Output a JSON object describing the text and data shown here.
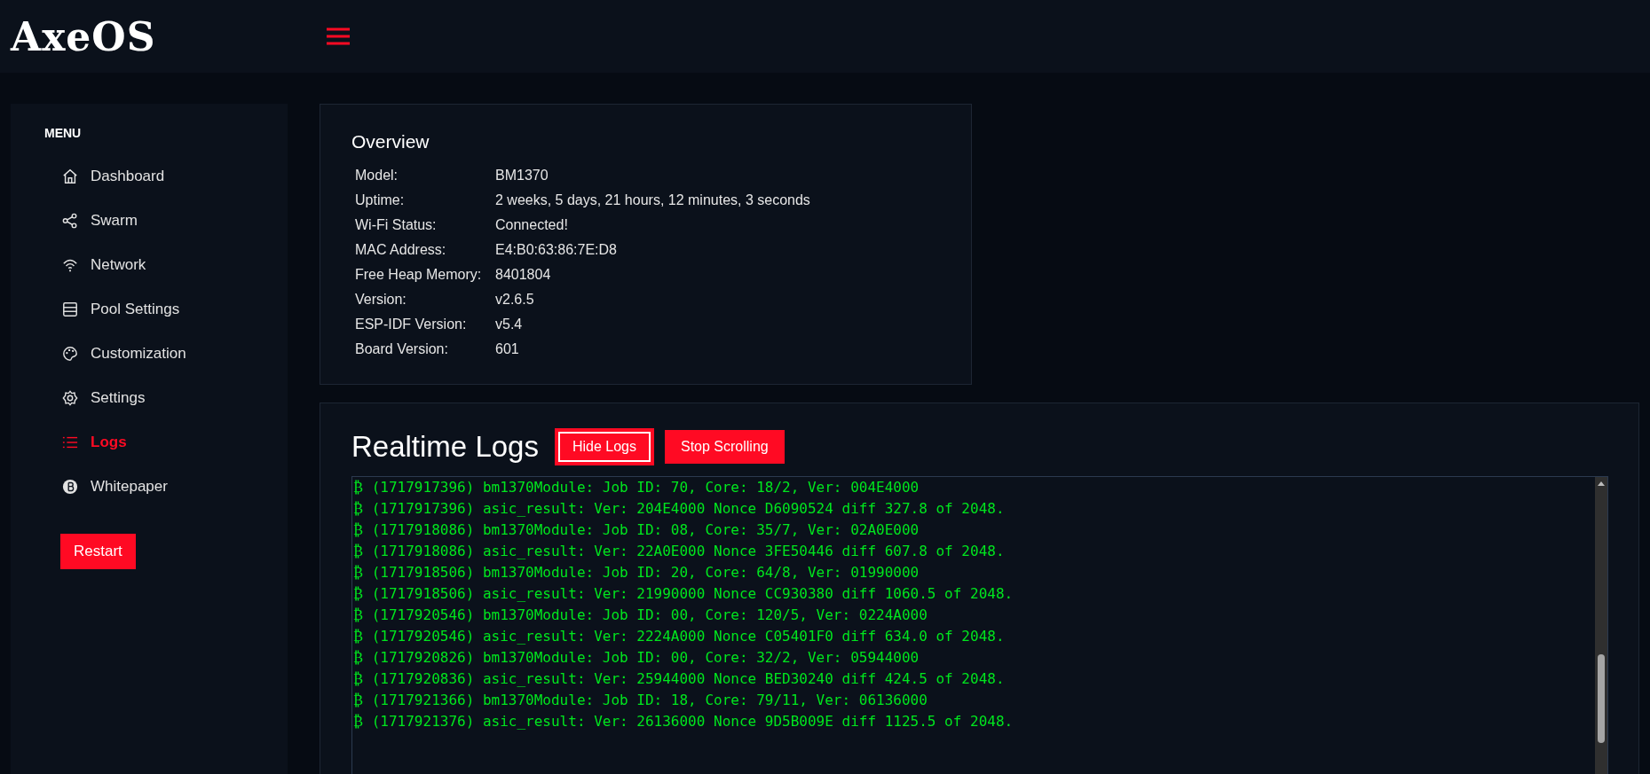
{
  "header": {
    "logo": "AxeOS"
  },
  "sidebar": {
    "heading": "MENU",
    "items": [
      {
        "label": "Dashboard",
        "selected": false
      },
      {
        "label": "Swarm",
        "selected": false
      },
      {
        "label": "Network",
        "selected": false
      },
      {
        "label": "Pool Settings",
        "selected": false
      },
      {
        "label": "Customization",
        "selected": false
      },
      {
        "label": "Settings",
        "selected": false
      },
      {
        "label": "Logs",
        "selected": true
      },
      {
        "label": "Whitepaper",
        "selected": false
      }
    ],
    "restart_button": "Restart"
  },
  "overview": {
    "title": "Overview",
    "rows": [
      {
        "label": "Model:",
        "value": "BM1370"
      },
      {
        "label": "Uptime:",
        "value": "2 weeks, 5 days, 21 hours, 12 minutes, 3 seconds"
      },
      {
        "label": "Wi-Fi Status:",
        "value": "Connected!"
      },
      {
        "label": "MAC Address:",
        "value": "E4:B0:63:86:7E:D8"
      },
      {
        "label": "Free Heap Memory:",
        "value": "8401804"
      },
      {
        "label": "Version:",
        "value": "v2.6.5"
      },
      {
        "label": "ESP-IDF Version:",
        "value": "v5.4"
      },
      {
        "label": "Board Version:",
        "value": "601"
      }
    ]
  },
  "logs": {
    "title": "Realtime Logs",
    "buttons": [
      {
        "label": "Hide Logs",
        "focused": true
      },
      {
        "label": "Stop Scrolling",
        "focused": false
      }
    ],
    "lines": [
      "₿ (1717917396) bm1370Module: Job ID: 70, Core: 18/2, Ver: 004E4000",
      "₿ (1717917396) asic_result: Ver: 204E4000 Nonce D6090524 diff 327.8 of 2048.",
      "₿ (1717918086) bm1370Module: Job ID: 08, Core: 35/7, Ver: 02A0E000",
      "₿ (1717918086) asic_result: Ver: 22A0E000 Nonce 3FE50446 diff 607.8 of 2048.",
      "₿ (1717918506) bm1370Module: Job ID: 20, Core: 64/8, Ver: 01990000",
      "₿ (1717918506) asic_result: Ver: 21990000 Nonce CC930380 diff 1060.5 of 2048.",
      "₿ (1717920546) bm1370Module: Job ID: 00, Core: 120/5, Ver: 0224A000",
      "₿ (1717920546) asic_result: Ver: 2224A000 Nonce C05401F0 diff 634.0 of 2048.",
      "₿ (1717920826) bm1370Module: Job ID: 00, Core: 32/2, Ver: 05944000",
      "₿ (1717920836) asic_result: Ver: 25944000 Nonce BED30240 diff 424.5 of 2048.",
      "₿ (1717921366) bm1370Module: Job ID: 18, Core: 79/11, Ver: 06136000",
      "₿ (1717921376) asic_result: Ver: 26136000 Nonce 9D5B009E diff 1125.5 of 2048."
    ]
  }
}
